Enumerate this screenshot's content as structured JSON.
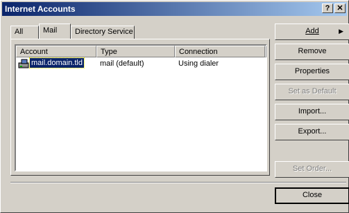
{
  "window": {
    "title": "Internet Accounts",
    "help_label": "?",
    "close_label": "✕"
  },
  "tabs": [
    {
      "label": "All"
    },
    {
      "label": "Mail",
      "selected": true
    },
    {
      "label": "Directory Service"
    }
  ],
  "list": {
    "columns": [
      "Account",
      "Type",
      "Connection"
    ],
    "rows": [
      {
        "account": "mail.domain.tld",
        "type": "mail (default)",
        "connection": "Using dialer",
        "selected": true
      }
    ]
  },
  "buttons": {
    "add": {
      "label": "Add",
      "arrow": "▶",
      "enabled": true
    },
    "remove": {
      "label": "Remove",
      "enabled": true
    },
    "properties": {
      "label": "Properties",
      "enabled": true
    },
    "set_default": {
      "label": "Set as Default",
      "enabled": false
    },
    "import": {
      "label": "Import...",
      "enabled": true
    },
    "export": {
      "label": "Export...",
      "enabled": true
    },
    "set_order": {
      "label": "Set Order...",
      "enabled": false
    },
    "close": {
      "label": "Close",
      "enabled": true
    }
  },
  "icons": {
    "account_row": "mail-account-icon"
  },
  "colors": {
    "titlebar_start": "#0a246a",
    "titlebar_end": "#a6caf0",
    "selection": "#0a246a",
    "face": "#d4d0c8"
  }
}
